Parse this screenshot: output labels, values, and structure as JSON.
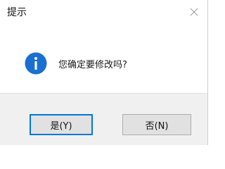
{
  "window": {
    "title": "提示",
    "close_icon": "close-icon"
  },
  "dialog": {
    "icon": "info-icon",
    "icon_color": "#1a6fd1",
    "message": "您确定要修改吗?"
  },
  "buttons": {
    "yes_label": "是(Y)",
    "no_label": "否(N)",
    "default": "yes",
    "accent_color": "#0078d7"
  }
}
